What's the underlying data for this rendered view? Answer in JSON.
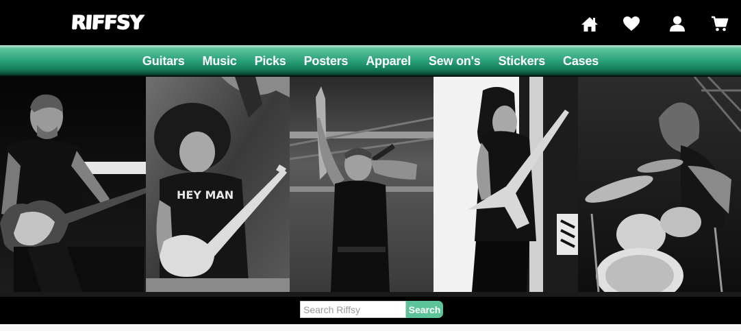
{
  "header": {
    "logo_text": "RIFFSY",
    "icons": [
      "home-icon",
      "heart-icon",
      "user-icon",
      "cart-icon"
    ]
  },
  "nav": {
    "items": [
      {
        "label": "Guitars"
      },
      {
        "label": "Music"
      },
      {
        "label": "Picks"
      },
      {
        "label": "Posters"
      },
      {
        "label": "Apparel"
      },
      {
        "label": "Sew on's"
      },
      {
        "label": "Stickers"
      },
      {
        "label": "Cases"
      }
    ]
  },
  "search": {
    "placeholder": "Search Riffsy",
    "button_label": "Search"
  },
  "colors": {
    "accent": "#5cc39b",
    "nav_dark": "#15805a",
    "background": "#000000"
  }
}
